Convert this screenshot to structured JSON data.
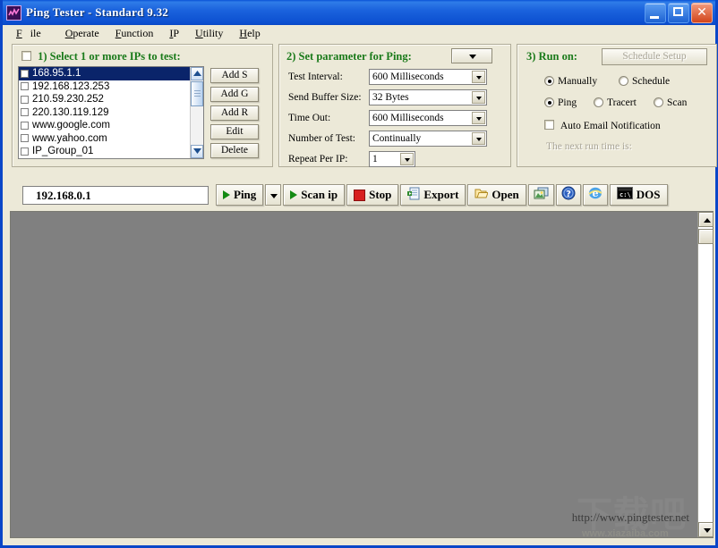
{
  "window": {
    "title": "Ping Tester - Standard  9.32",
    "app_icon": "chart-line-icon",
    "minimize": "minimize-icon",
    "maximize": "maximize-icon",
    "close": "close-icon"
  },
  "menu": {
    "items": [
      {
        "label": "File",
        "accel": "F"
      },
      {
        "label": "Operate",
        "accel": "O"
      },
      {
        "label": "Function",
        "accel": "F"
      },
      {
        "label": "IP",
        "accel": "I"
      },
      {
        "label": "Utility",
        "accel": "U"
      },
      {
        "label": "Help",
        "accel": "H"
      }
    ]
  },
  "section1": {
    "title": "1) Select 1 or more IPs to test:",
    "select_all_checked": false,
    "list": [
      {
        "label": "168.95.1.1",
        "checked": false,
        "selected": true
      },
      {
        "label": "192.168.123.253",
        "checked": false,
        "selected": false
      },
      {
        "label": "210.59.230.252",
        "checked": false,
        "selected": false
      },
      {
        "label": "220.130.119.129",
        "checked": false,
        "selected": false
      },
      {
        "label": "www.google.com",
        "checked": false,
        "selected": false
      },
      {
        "label": "www.yahoo.com",
        "checked": false,
        "selected": false
      },
      {
        "label": "IP_Group_01",
        "checked": false,
        "selected": false
      }
    ],
    "buttons": [
      {
        "label": "Add S"
      },
      {
        "label": "Add G"
      },
      {
        "label": "Add R"
      },
      {
        "label": "Edit"
      },
      {
        "label": "Delete"
      }
    ]
  },
  "section2": {
    "title": "2) Set parameter for Ping:",
    "expand_icon": "chevron-down-icon",
    "fields": [
      {
        "label": "Test Interval:",
        "value": "600  Milliseconds"
      },
      {
        "label": "Send Buffer Size:",
        "value": "32  Bytes"
      },
      {
        "label": "Time Out:",
        "value": "600  Milliseconds"
      },
      {
        "label": "Number of Test:",
        "value": "Continually"
      }
    ],
    "repeat_label": "Repeat Per IP:",
    "repeat_value": "1"
  },
  "section3": {
    "title": "3) Run on:",
    "schedule_setup": "Schedule Setup",
    "schedule_setup_enabled": false,
    "radios_mode": [
      {
        "label": "Manually",
        "selected": true
      },
      {
        "label": "Schedule",
        "selected": false
      }
    ],
    "radios_type": [
      {
        "label": "Ping",
        "selected": true
      },
      {
        "label": "Tracert",
        "selected": false
      },
      {
        "label": "Scan",
        "selected": false
      }
    ],
    "email_label": "Auto Email Notification",
    "email_checked": false,
    "next_run_label": "The next run time is:"
  },
  "toolbar": {
    "ip_value": "192.168.0.1",
    "ping": {
      "label": "Ping",
      "icon": "play-triangle-icon"
    },
    "ping_dropdown_icon": "chevron-down-icon",
    "scan_ip": {
      "label": "Scan ip",
      "icon": "play-triangle-icon"
    },
    "stop": {
      "label": "Stop",
      "icon": "stop-square-icon"
    },
    "export": {
      "label": "Export",
      "icon": "document-export-icon"
    },
    "open": {
      "label": "Open",
      "icon": "folder-open-icon"
    },
    "screenshot": {
      "label": "",
      "icon": "image-capture-icon"
    },
    "help": {
      "label": "",
      "icon": "question-help-icon"
    },
    "browser": {
      "label": "",
      "icon": "internet-explorer-icon"
    },
    "dos": {
      "label": "DOS",
      "icon": "console-prompt-icon"
    }
  },
  "content": {
    "watermark_url": "http://www.pingtester.net",
    "overlay_cjk": "下载吧",
    "overlay_site": "www.xiazaiba.com",
    "scroll_up_icon": "scroll-up-arrow-icon",
    "scroll_down_icon": "scroll-down-arrow-icon"
  },
  "colors": {
    "title_blue": "#0a46c8",
    "face": "#ece9d8",
    "group_green": "#1a7a1a",
    "selection_blue": "#0a246a",
    "content_gray": "#808080",
    "play_green": "#138a13",
    "stop_red": "#d82020"
  }
}
